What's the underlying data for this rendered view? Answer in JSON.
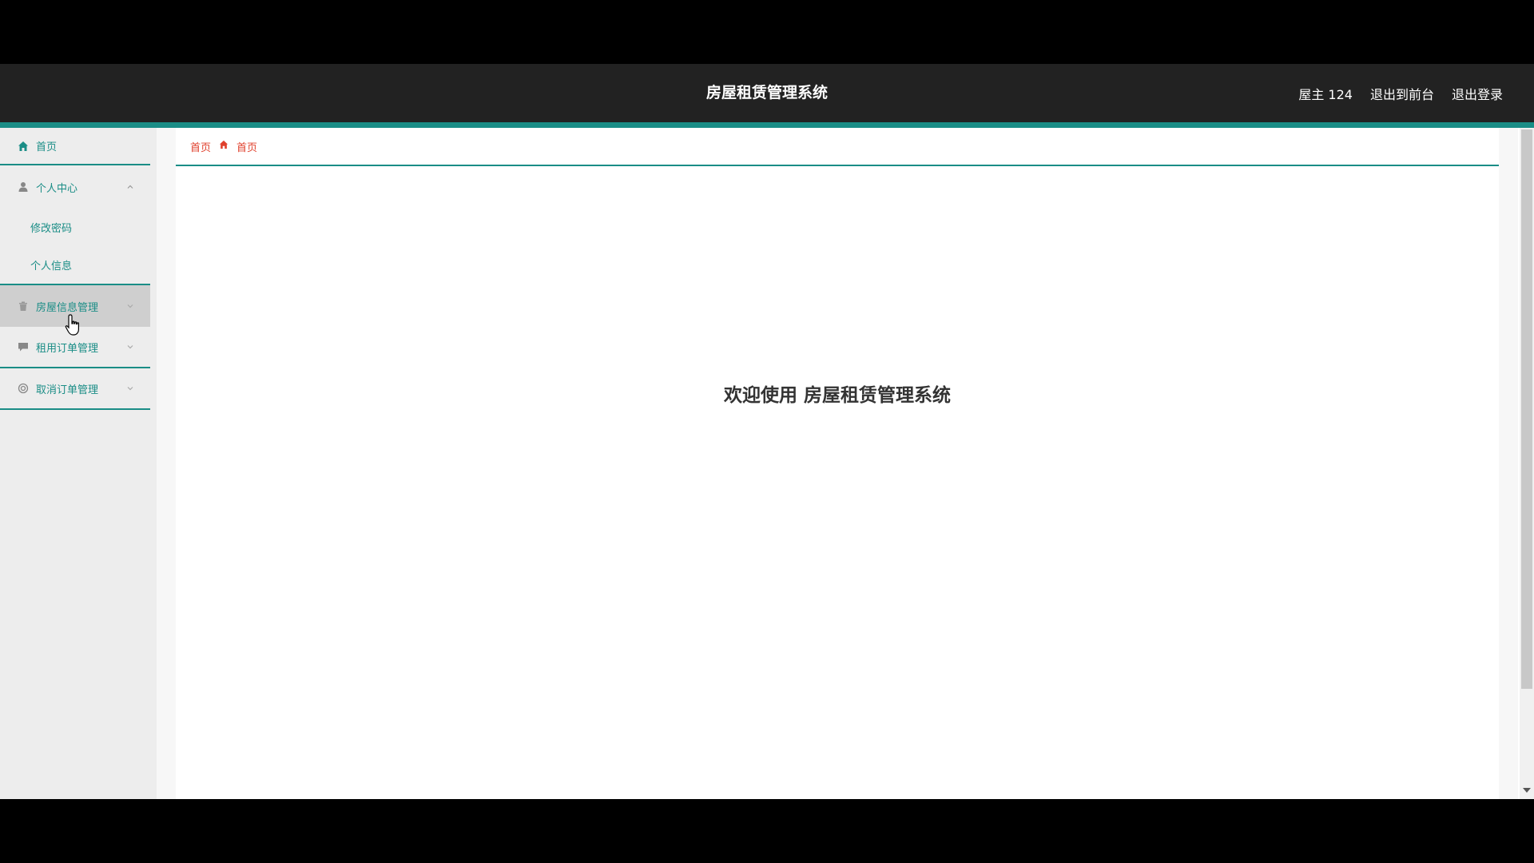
{
  "header": {
    "title": "房屋租赁管理系统",
    "user_label": "屋主 124",
    "front_link": "退出到前台",
    "logout_link": "退出登录"
  },
  "sidebar": {
    "items": [
      {
        "label": "首页",
        "icon": "home-icon"
      },
      {
        "label": "个人中心",
        "icon": "user-icon",
        "expanded": true,
        "children": [
          {
            "label": "修改密码"
          },
          {
            "label": "个人信息"
          }
        ]
      },
      {
        "label": "房屋信息管理",
        "icon": "trash-icon",
        "hovered": true
      },
      {
        "label": "租用订单管理",
        "icon": "comment-icon"
      },
      {
        "label": "取消订单管理",
        "icon": "cancel-circle-icon"
      }
    ]
  },
  "breadcrumb": {
    "root": "首页",
    "current": "首页"
  },
  "main": {
    "welcome_text": "欢迎使用 房屋租赁管理系统"
  },
  "colors": {
    "accent": "#1a8d86",
    "breadcrumb": "#e0402c",
    "header_bg": "#222222"
  }
}
